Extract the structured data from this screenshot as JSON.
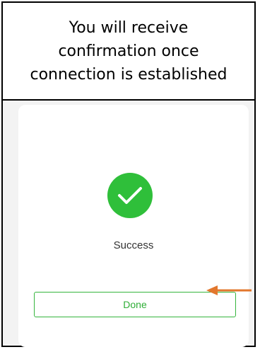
{
  "caption": {
    "text": "You will receive\nconfirmation once\nconnection is established"
  },
  "dialog": {
    "status_label": "Success",
    "done_label": "Done",
    "icon": "checkmark-circle-icon"
  },
  "colors": {
    "success_green": "#2fbf3a",
    "button_text_green": "#2fae37",
    "arrow_orange": "#e2772d",
    "screen_background": "#f3f3f3"
  }
}
